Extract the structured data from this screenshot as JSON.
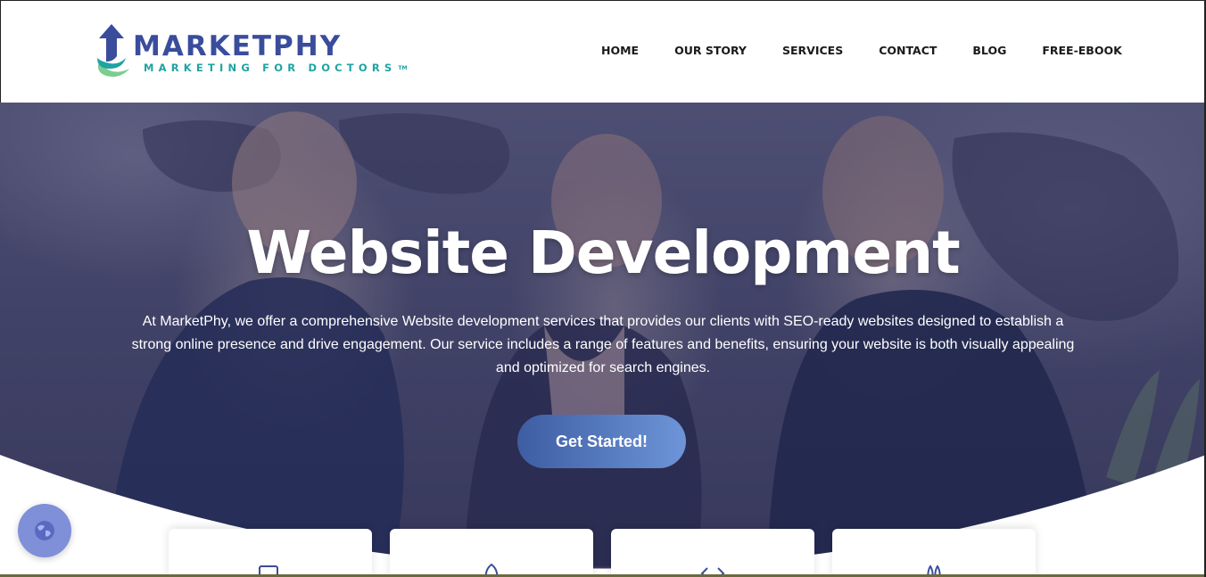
{
  "brand": {
    "name": "MarketPhy",
    "logo_title": "MARKETPHY",
    "logo_tagline": "MARKETING FOR DOCTORS",
    "logo_tm": "TM",
    "colors": {
      "primary": "#3a4d9c",
      "teal": "#1fa3a3",
      "green": "#7ccd8f"
    }
  },
  "nav": {
    "items": [
      {
        "label": "HOME"
      },
      {
        "label": "OUR STORY"
      },
      {
        "label": "SERVICES"
      },
      {
        "label": "CONTACT"
      },
      {
        "label": "BLOG"
      },
      {
        "label": "FREE-EBOOK"
      }
    ]
  },
  "hero": {
    "title": "Website Development",
    "description": "At MarketPhy, we offer a comprehensive Website development services that provides our clients with SEO-ready websites designed to establish a strong online presence and drive engagement. Our service includes a range of features and benefits, ensuring your website is both visually appealing and optimized for search engines.",
    "cta_label": "Get Started!",
    "cta_colors": [
      "#3e5da3",
      "#6d95d8"
    ]
  },
  "cards": [
    {
      "icon": "laptop-icon"
    },
    {
      "icon": "rocket-icon"
    },
    {
      "icon": "code-icon"
    },
    {
      "icon": "bunny-icon"
    }
  ],
  "floating_button": {
    "icon": "globe-icon",
    "color": "#7f8fd8"
  }
}
